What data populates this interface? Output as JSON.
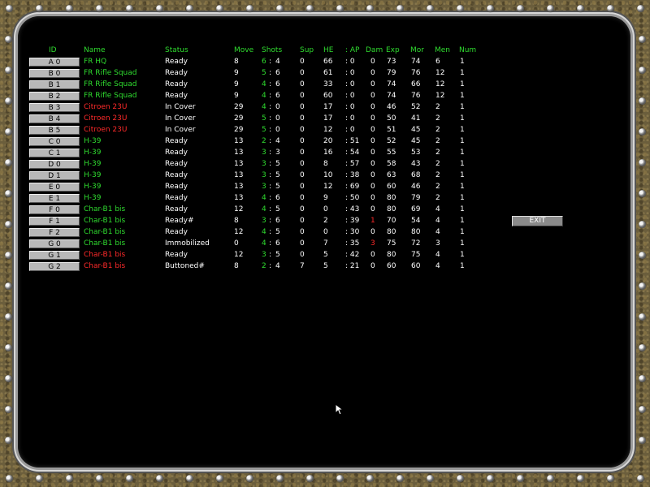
{
  "headers": {
    "id": "ID",
    "name": "Name",
    "status": "Status",
    "move": "Move",
    "shots": "Shots",
    "sup": "Sup",
    "he": "HE",
    "ap": ": AP",
    "dam": "Dam",
    "exp": "Exp",
    "mor": "Mor",
    "men": "Men",
    "num": "Num"
  },
  "exit_label": "EXIT",
  "colors": {
    "green": "#2fdc2f",
    "red": "#ff2a2a",
    "white": "#ffffff",
    "background": "#000000"
  },
  "rows": [
    {
      "id": "A 0",
      "name": "FR HQ",
      "name_color": "green",
      "status": "Ready",
      "move": "8",
      "shots_a": "6",
      "shots_b": "4",
      "sup": "0",
      "he": "66",
      "ap": ": 0",
      "dam": "0",
      "dam_color": "white",
      "exp": "73",
      "mor": "74",
      "men": "6",
      "num": "1"
    },
    {
      "id": "B 0",
      "name": "FR Rifle Squad",
      "name_color": "green",
      "status": "Ready",
      "move": "9",
      "shots_a": "5",
      "shots_b": "6",
      "sup": "0",
      "he": "61",
      "ap": ": 0",
      "dam": "0",
      "dam_color": "white",
      "exp": "79",
      "mor": "76",
      "men": "12",
      "num": "1"
    },
    {
      "id": "B 1",
      "name": "FR Rifle Squad",
      "name_color": "green",
      "status": "Ready",
      "move": "9",
      "shots_a": "4",
      "shots_b": "6",
      "sup": "0",
      "he": "33",
      "ap": ": 0",
      "dam": "0",
      "dam_color": "white",
      "exp": "74",
      "mor": "66",
      "men": "12",
      "num": "1"
    },
    {
      "id": "B 2",
      "name": "FR Rifle Squad",
      "name_color": "green",
      "status": "Ready",
      "move": "9",
      "shots_a": "4",
      "shots_b": "6",
      "sup": "0",
      "he": "60",
      "ap": ": 0",
      "dam": "0",
      "dam_color": "white",
      "exp": "74",
      "mor": "76",
      "men": "12",
      "num": "1"
    },
    {
      "id": "B 3",
      "name": "Citroen 23U",
      "name_color": "red",
      "status": "In Cover",
      "move": "29",
      "shots_a": "4",
      "shots_b": "0",
      "sup": "0",
      "he": "17",
      "ap": ": 0",
      "dam": "0",
      "dam_color": "white",
      "exp": "46",
      "mor": "52",
      "men": "2",
      "num": "1"
    },
    {
      "id": "B 4",
      "name": "Citroen 23U",
      "name_color": "red",
      "status": "In Cover",
      "move": "29",
      "shots_a": "5",
      "shots_b": "0",
      "sup": "0",
      "he": "17",
      "ap": ": 0",
      "dam": "0",
      "dam_color": "white",
      "exp": "50",
      "mor": "41",
      "men": "2",
      "num": "1"
    },
    {
      "id": "B 5",
      "name": "Citroen 23U",
      "name_color": "red",
      "status": "In Cover",
      "move": "29",
      "shots_a": "5",
      "shots_b": "0",
      "sup": "0",
      "he": "12",
      "ap": ": 0",
      "dam": "0",
      "dam_color": "white",
      "exp": "51",
      "mor": "45",
      "men": "2",
      "num": "1"
    },
    {
      "id": "C 0",
      "name": "H-39",
      "name_color": "green",
      "status": "Ready",
      "move": "13",
      "shots_a": "2",
      "shots_b": "4",
      "sup": "0",
      "he": "20",
      "ap": ": 51",
      "dam": "0",
      "dam_color": "white",
      "exp": "52",
      "mor": "45",
      "men": "2",
      "num": "1"
    },
    {
      "id": "C 1",
      "name": "H-39",
      "name_color": "green",
      "status": "Ready",
      "move": "13",
      "shots_a": "3",
      "shots_b": "3",
      "sup": "0",
      "he": "16",
      "ap": ": 54",
      "dam": "0",
      "dam_color": "white",
      "exp": "55",
      "mor": "53",
      "men": "2",
      "num": "1"
    },
    {
      "id": "D 0",
      "name": "H-39",
      "name_color": "green",
      "status": "Ready",
      "move": "13",
      "shots_a": "3",
      "shots_b": "5",
      "sup": "0",
      "he": "8",
      "ap": ": 57",
      "dam": "0",
      "dam_color": "white",
      "exp": "58",
      "mor": "43",
      "men": "2",
      "num": "1"
    },
    {
      "id": "D 1",
      "name": "H-39",
      "name_color": "green",
      "status": "Ready",
      "move": "13",
      "shots_a": "3",
      "shots_b": "5",
      "sup": "0",
      "he": "10",
      "ap": ": 38",
      "dam": "0",
      "dam_color": "white",
      "exp": "63",
      "mor": "68",
      "men": "2",
      "num": "1"
    },
    {
      "id": "E 0",
      "name": "H-39",
      "name_color": "green",
      "status": "Ready",
      "move": "13",
      "shots_a": "3",
      "shots_b": "5",
      "sup": "0",
      "he": "12",
      "ap": ": 69",
      "dam": "0",
      "dam_color": "white",
      "exp": "60",
      "mor": "46",
      "men": "2",
      "num": "1"
    },
    {
      "id": "E 1",
      "name": "H-39",
      "name_color": "green",
      "status": "Ready",
      "move": "13",
      "shots_a": "4",
      "shots_b": "6",
      "sup": "0",
      "he": "9",
      "ap": ": 50",
      "dam": "0",
      "dam_color": "white",
      "exp": "80",
      "mor": "79",
      "men": "2",
      "num": "1"
    },
    {
      "id": "F 0",
      "name": "Char-B1 bis",
      "name_color": "green",
      "status": "Ready",
      "move": "12",
      "shots_a": "4",
      "shots_b": "5",
      "sup": "0",
      "he": "0",
      "ap": ": 43",
      "dam": "0",
      "dam_color": "white",
      "exp": "80",
      "mor": "69",
      "men": "4",
      "num": "1"
    },
    {
      "id": "F 1",
      "name": "Char-B1 bis",
      "name_color": "green",
      "status": "Ready#",
      "move": "8",
      "shots_a": "3",
      "shots_b": "6",
      "sup": "0",
      "he": "2",
      "ap": ": 39",
      "dam": "1",
      "dam_color": "red",
      "exp": "70",
      "mor": "54",
      "men": "4",
      "num": "1"
    },
    {
      "id": "F 2",
      "name": "Char-B1 bis",
      "name_color": "green",
      "status": "Ready",
      "move": "12",
      "shots_a": "4",
      "shots_b": "5",
      "sup": "0",
      "he": "0",
      "ap": ": 30",
      "dam": "0",
      "dam_color": "white",
      "exp": "80",
      "mor": "80",
      "men": "4",
      "num": "1"
    },
    {
      "id": "G 0",
      "name": "Char-B1 bis",
      "name_color": "green",
      "status": "Immobilized",
      "move": "0",
      "shots_a": "4",
      "shots_b": "6",
      "sup": "0",
      "he": "7",
      "ap": ": 35",
      "dam": "3",
      "dam_color": "red",
      "exp": "75",
      "mor": "72",
      "men": "3",
      "num": "1"
    },
    {
      "id": "G 1",
      "name": "Char-B1 bis",
      "name_color": "red",
      "status": "Ready",
      "move": "12",
      "shots_a": "3",
      "shots_b": "5",
      "sup": "0",
      "he": "5",
      "ap": ": 42",
      "dam": "0",
      "dam_color": "white",
      "exp": "80",
      "mor": "75",
      "men": "4",
      "num": "1"
    },
    {
      "id": "G 2",
      "name": "Char-B1 bis",
      "name_color": "red",
      "status": "Buttoned#",
      "move": "8",
      "shots_a": "2",
      "shots_b": "4",
      "sup": "7",
      "he": "5",
      "ap": ": 21",
      "dam": "0",
      "dam_color": "white",
      "exp": "60",
      "mor": "60",
      "men": "4",
      "num": "1"
    }
  ]
}
